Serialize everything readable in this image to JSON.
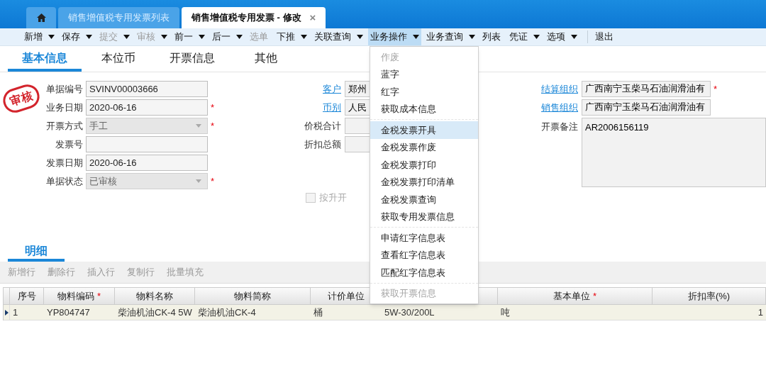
{
  "tabs": [
    {
      "label": "销售增值税专用发票列表",
      "selected": false,
      "closable": false
    },
    {
      "label": "销售增值税专用发票 - 修改",
      "selected": true,
      "closable": true,
      "close": "×"
    }
  ],
  "toolbar": [
    {
      "label": "新增",
      "caret": true,
      "disabled": false,
      "selected": false
    },
    {
      "label": "保存",
      "caret": true,
      "disabled": false,
      "selected": false
    },
    {
      "label": "提交",
      "caret": true,
      "disabled": true,
      "selected": false
    },
    {
      "label": "审核",
      "caret": true,
      "disabled": true,
      "selected": false
    },
    {
      "label": "前一",
      "caret": true,
      "disabled": false,
      "selected": false
    },
    {
      "label": "后一",
      "caret": true,
      "disabled": false,
      "selected": false
    },
    {
      "label": "选单",
      "caret": false,
      "disabled": true,
      "selected": false
    },
    {
      "label": "下推",
      "caret": true,
      "disabled": false,
      "selected": false
    },
    {
      "label": "关联查询",
      "caret": true,
      "disabled": false,
      "selected": false
    },
    {
      "label": "业务操作",
      "caret": true,
      "disabled": false,
      "selected": true
    },
    {
      "label": "业务查询",
      "caret": true,
      "disabled": false,
      "selected": false
    },
    {
      "label": "列表",
      "caret": false,
      "disabled": false,
      "selected": false
    },
    {
      "label": "凭证",
      "caret": true,
      "disabled": false,
      "selected": false
    },
    {
      "label": "选项",
      "caret": true,
      "disabled": false,
      "selected": false
    },
    {
      "label": "退出",
      "caret": false,
      "disabled": false,
      "selected": false,
      "separator_before": true
    }
  ],
  "section_tabs": [
    {
      "label": "基本信息",
      "selected": true
    },
    {
      "label": "本位币",
      "selected": false
    },
    {
      "label": "开票信息",
      "selected": false
    },
    {
      "label": "其他",
      "selected": false
    }
  ],
  "stamp": "审核",
  "required_mark": "*",
  "form_left": [
    {
      "label": "单据编号",
      "value": "SVINV00003666",
      "kind": "text",
      "required": false,
      "disabled": false
    },
    {
      "label": "业务日期",
      "value": "2020-06-16",
      "kind": "text",
      "required": true,
      "disabled": false
    },
    {
      "label": "开票方式",
      "value": "手工",
      "kind": "select",
      "required": true,
      "disabled": true
    },
    {
      "label": "发票号",
      "kind": "text",
      "required": false,
      "disabled": false
    },
    {
      "label": "发票日期",
      "value": "2020-06-16",
      "kind": "text",
      "required": false,
      "disabled": false
    },
    {
      "label": "单据状态",
      "value": "已审核",
      "kind": "select",
      "required": true,
      "disabled": true
    }
  ],
  "form_middle": [
    {
      "label": "客户",
      "value": "郑州",
      "link": true
    },
    {
      "label": "币别",
      "value": "人民",
      "link": true
    },
    {
      "label": "价税合计",
      "link": false
    },
    {
      "label": "折扣总额",
      "link": false
    }
  ],
  "checkbox": {
    "label": "按升开",
    "checked": false,
    "disabled": true
  },
  "form_right": [
    {
      "label": "结算组织",
      "value": "广西南宁玉柴马石油润滑油有",
      "link": true,
      "required": true
    },
    {
      "label": "销售组织",
      "value": "广西南宁玉柴马石油润滑油有",
      "link": true,
      "required": false
    }
  ],
  "remark": {
    "label": "开票备注",
    "value": "AR2006156119"
  },
  "detail_tab": {
    "label": "明细",
    "selected": true
  },
  "row_actions": [
    {
      "label": "新增行",
      "disabled": true
    },
    {
      "label": "删除行",
      "disabled": true
    },
    {
      "label": "插入行",
      "disabled": true
    },
    {
      "label": "复制行",
      "disabled": true
    },
    {
      "label": "批量填充",
      "disabled": true
    }
  ],
  "table": {
    "columns": [
      {
        "label": "序号",
        "required": false
      },
      {
        "label": "物料编码",
        "required": true
      },
      {
        "label": "物料名称",
        "required": false
      },
      {
        "label": "物料简称",
        "required": false
      },
      {
        "label": "计价单位",
        "required": false
      },
      {},
      {
        "label": "基本单位",
        "required": true
      },
      {
        "label": "折扣率(%)",
        "required": false
      }
    ],
    "rows": [
      {
        "current": true,
        "cells": [
          "1",
          "YP804747",
          "柴油机油CK-4 5W",
          "柴油机油CK-4",
          "桶",
          "5W-30/200L",
          "吨",
          "1"
        ]
      }
    ]
  },
  "menu": {
    "groups": [
      [
        {
          "label": "作废",
          "disabled": true,
          "selected": false
        },
        {
          "label": "蓝字",
          "disabled": false,
          "selected": false
        },
        {
          "label": "红字",
          "disabled": false,
          "selected": false
        },
        {
          "label": "获取成本信息",
          "disabled": false,
          "selected": false
        }
      ],
      [
        {
          "label": "金税发票开具",
          "disabled": false,
          "selected": true
        },
        {
          "label": "金税发票作废",
          "disabled": false,
          "selected": false
        },
        {
          "label": "金税发票打印",
          "disabled": false,
          "selected": false
        },
        {
          "label": "金税发票打印清单",
          "disabled": false,
          "selected": false
        },
        {
          "label": "金税发票查询",
          "disabled": false,
          "selected": false
        },
        {
          "label": "获取专用发票信息",
          "disabled": false,
          "selected": false
        }
      ],
      [
        {
          "label": "申请红字信息表",
          "disabled": false,
          "selected": false
        },
        {
          "label": "查看红字信息表",
          "disabled": false,
          "selected": false
        },
        {
          "label": "匹配红字信息表",
          "disabled": false,
          "selected": false
        }
      ],
      [
        {
          "label": "获取开票信息",
          "disabled": true,
          "selected": false
        }
      ]
    ]
  }
}
